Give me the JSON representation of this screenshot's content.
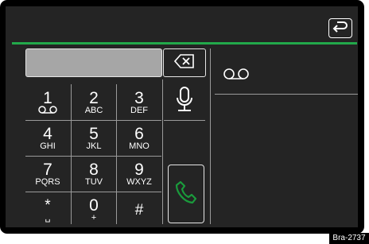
{
  "phone": {
    "number_value": "",
    "back_icon": "back-arrow-icon",
    "delete_icon": "backspace-icon",
    "mic_icon": "microphone-icon",
    "call_icon": "phone-handset-icon",
    "voicemail_icon": "voicemail-icon",
    "keys": [
      {
        "digit": "1",
        "letters": "",
        "icon": "voicemail-icon"
      },
      {
        "digit": "2",
        "letters": "ABC"
      },
      {
        "digit": "3",
        "letters": "DEF"
      },
      {
        "digit": "4",
        "letters": "GHI"
      },
      {
        "digit": "5",
        "letters": "JKL"
      },
      {
        "digit": "6",
        "letters": "MNO"
      },
      {
        "digit": "7",
        "letters": "PQRS"
      },
      {
        "digit": "8",
        "letters": "TUV"
      },
      {
        "digit": "9",
        "letters": "WXYZ"
      },
      {
        "digit": "*",
        "letters": "␣"
      },
      {
        "digit": "0",
        "letters": "+"
      },
      {
        "digit": "#",
        "letters": ""
      }
    ],
    "colors": {
      "accent": "#22a84a",
      "call_icon": "#1a9b3c",
      "screen": "#242424",
      "field": "#a6a6a6"
    }
  },
  "figure_tag": "Bra-2737"
}
